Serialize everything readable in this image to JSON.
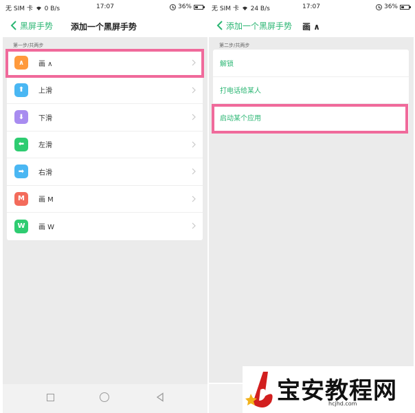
{
  "left_screen": {
    "status": {
      "carrier": "无 SIM 卡",
      "speed": "0 B/s",
      "time": "17:07",
      "battery": "36%"
    },
    "nav": {
      "back_label": "黑屏手势",
      "title": "添加一个黑屏手势"
    },
    "step": "第一步/共两步",
    "items": [
      {
        "icon_name": "caret-up-icon",
        "glyph": "∧",
        "color": "#ff9a3c",
        "label": "画 ∧"
      },
      {
        "icon_name": "arrow-up-icon",
        "glyph": "⬆",
        "color": "#4ab7f3",
        "label": "上滑"
      },
      {
        "icon_name": "arrow-down-icon",
        "glyph": "⬇",
        "color": "#a88cf0",
        "label": "下滑"
      },
      {
        "icon_name": "arrow-left-icon",
        "glyph": "⬅",
        "color": "#2ecc71",
        "label": "左滑"
      },
      {
        "icon_name": "arrow-right-icon",
        "glyph": "➡",
        "color": "#4ab7f3",
        "label": "右滑"
      },
      {
        "icon_name": "letter-m-icon",
        "glyph": "M",
        "color": "#f36b5b",
        "label": "画 M"
      },
      {
        "icon_name": "letter-w-icon",
        "glyph": "W",
        "color": "#2ecc71",
        "label": "画 W"
      }
    ]
  },
  "right_screen": {
    "status": {
      "carrier": "无 SIM 卡",
      "speed": "24 B/s",
      "time": "17:07",
      "battery": "36%"
    },
    "nav": {
      "back_label": "添加一个黑屏手势",
      "title": "画 ∧"
    },
    "step": "第二步/共两步",
    "items": [
      {
        "label": "解锁"
      },
      {
        "label": "打电话给某人"
      },
      {
        "label": "启动某个应用"
      }
    ]
  },
  "watermark": {
    "title": "宝安教程网",
    "url": "hcjhd.com"
  },
  "colors": {
    "accent": "#2bb673",
    "highlight": "#f06a9b",
    "background": "#ebebeb"
  }
}
